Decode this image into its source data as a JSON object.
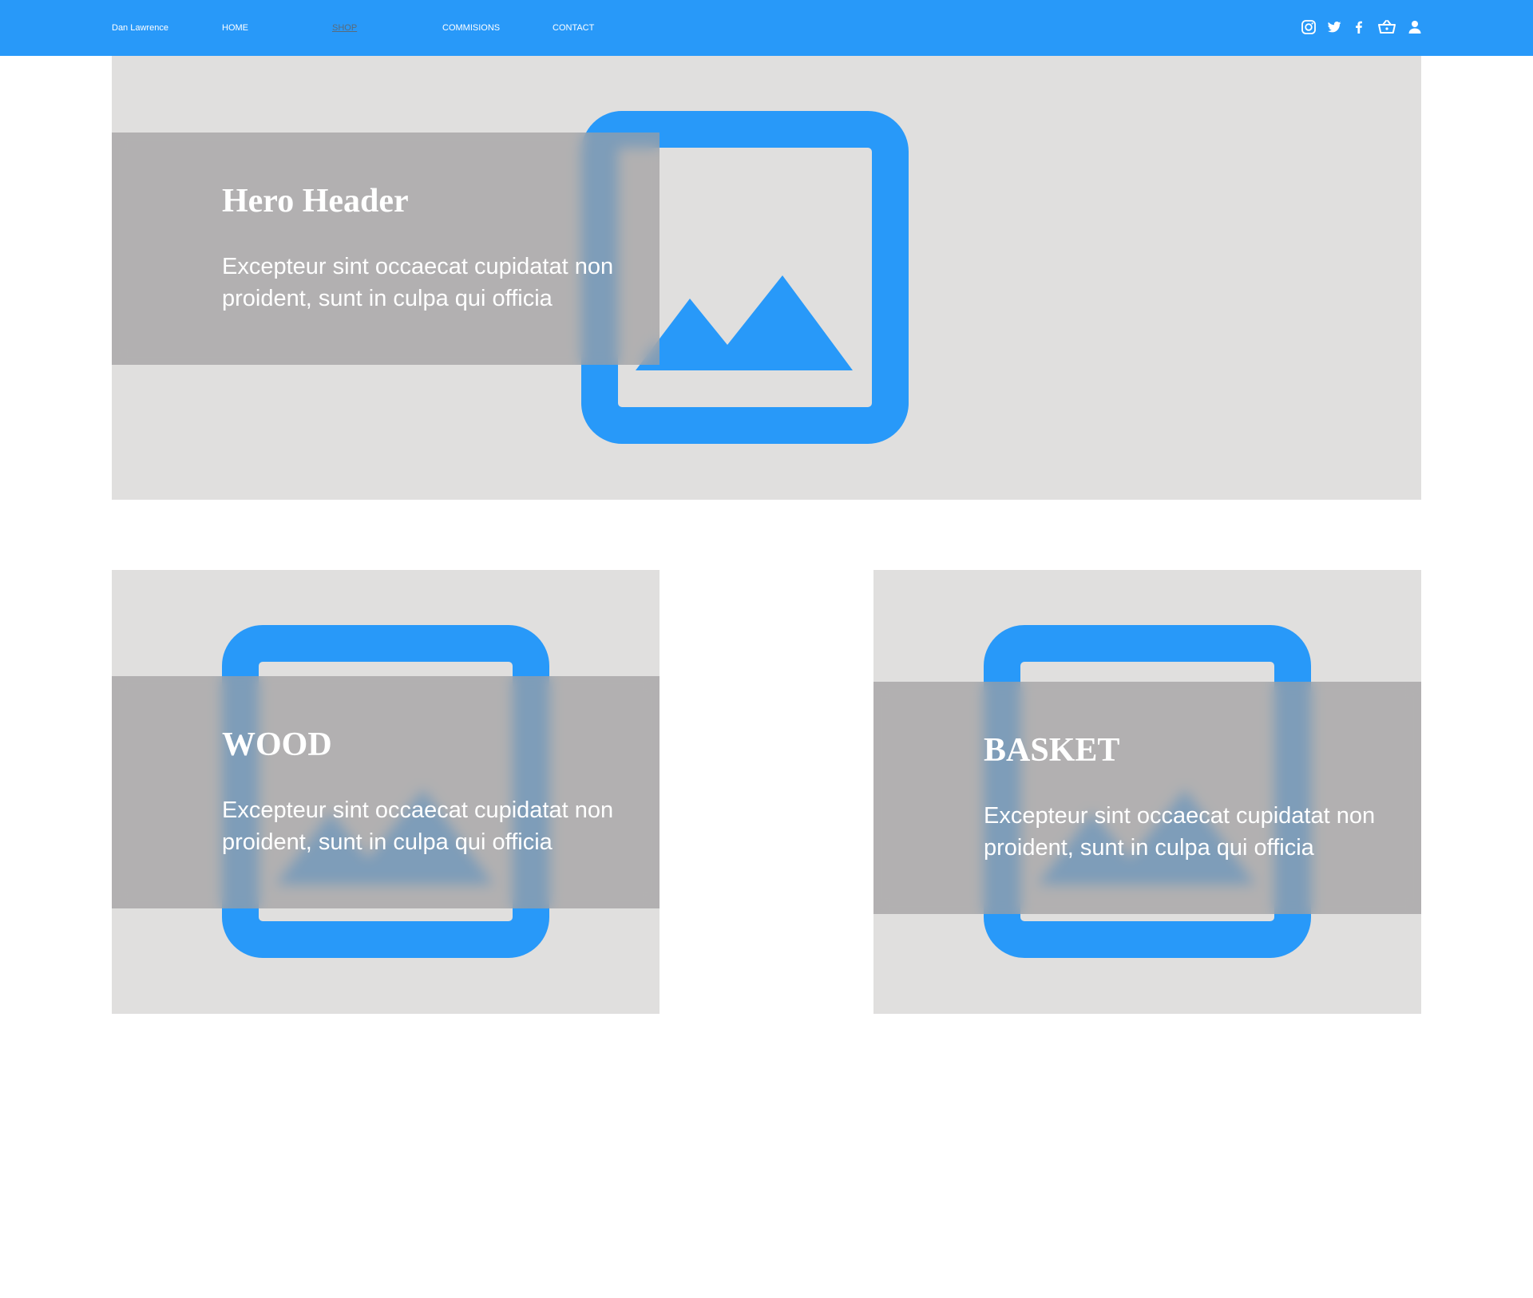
{
  "header": {
    "brand": "Dan Lawrence",
    "nav": [
      {
        "label": "HOME",
        "active": false
      },
      {
        "label": "SHOP",
        "active": true
      },
      {
        "label": "COMMISIONS",
        "active": false
      },
      {
        "label": "CONTACT",
        "active": false
      }
    ],
    "icons": [
      "instagram-icon",
      "twitter-icon",
      "facebook-icon",
      "basket-icon",
      "user-icon"
    ]
  },
  "hero": {
    "title": "Hero Header",
    "text": "Excepteur sint occaecat cupidatat non proident, sunt in culpa qui officia"
  },
  "cards": [
    {
      "title": "WOOD",
      "text": "Excepteur sint occaecat cupidatat non proident, sunt in culpa qui officia"
    },
    {
      "title": "BASKET",
      "text": "Excepteur sint occaecat cupidatat non proident, sunt in culpa qui officia"
    }
  ],
  "colors": {
    "accent": "#2899f9",
    "panel": "#e0dfde",
    "overlay": "#b5b4b5",
    "text_on_overlay": "#ffffff"
  }
}
